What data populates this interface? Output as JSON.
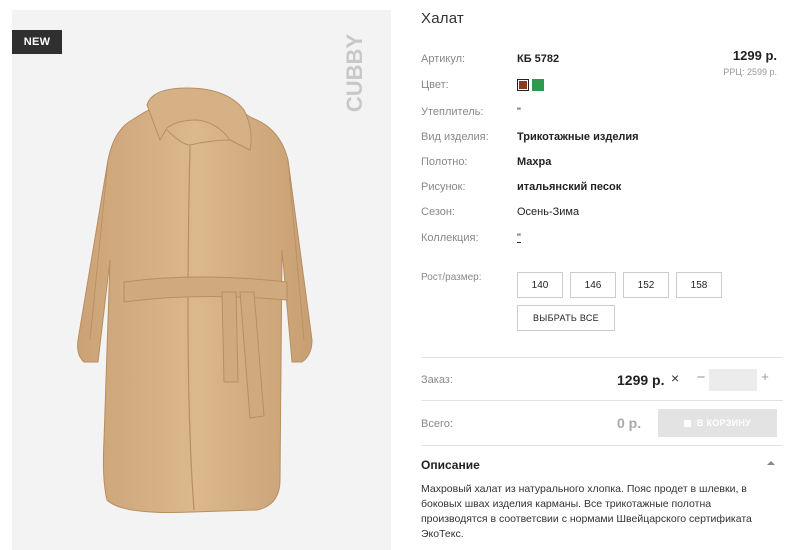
{
  "badge": {
    "new_label": "NEW"
  },
  "brand": {
    "logo_text": "CUBBY"
  },
  "product": {
    "title": "Халат",
    "price": "1299 р.",
    "rrp": "РРЦ: 2599 р."
  },
  "attributes": [
    {
      "label": "Артикул:",
      "value": "КБ 5782",
      "bold": true
    },
    {
      "label": "Цвет:",
      "value": "",
      "bold": false
    },
    {
      "label": "Утеплитель:",
      "value": "\"",
      "bold": false
    },
    {
      "label": "Вид изделия:",
      "value": "Трикотажные изделия",
      "bold": true
    },
    {
      "label": "Полотно:",
      "value": "Махра",
      "bold": true
    },
    {
      "label": "Рисунок:",
      "value": "итальянский песок",
      "bold": true
    },
    {
      "label": "Сезон:",
      "value": "Осень-Зима",
      "bold": false
    },
    {
      "label": "Коллекция:",
      "value": "\"",
      "bold": false
    }
  ],
  "colors": [
    {
      "name": "brown",
      "hex": "#8a3a20",
      "selected": true
    },
    {
      "name": "green",
      "hex": "#2e9a50",
      "selected": false
    }
  ],
  "sizes": {
    "label": "Рост/размер:",
    "options": [
      "140",
      "146",
      "152",
      "158"
    ],
    "select_all_label": "ВЫБРАТЬ ВСЕ"
  },
  "order": {
    "label": "Заказ:",
    "price": "1299 р.",
    "multiply": "×",
    "minus": "−",
    "plus": "+",
    "quantity": ""
  },
  "total": {
    "label": "Всего:",
    "value": "0 р.",
    "cart_button_label": "В КОРЗИНУ"
  },
  "description": {
    "title": "Описание",
    "text": "Махровый халат из натурального хлопка. Пояс продет в шлевки, в боковых швах изделия карманы. Все трикотажные полотна производятся в соответсвии с нормами Швейцарского сертификата ЭкоТекс."
  },
  "icons": {
    "collapse": "chevron-up-icon",
    "cart": "cart-icon"
  },
  "accent_colors": {
    "badge_bg": "#2f2f2f",
    "cart_button_bg": "#e3e3e3",
    "robe": "#d8b48a"
  }
}
